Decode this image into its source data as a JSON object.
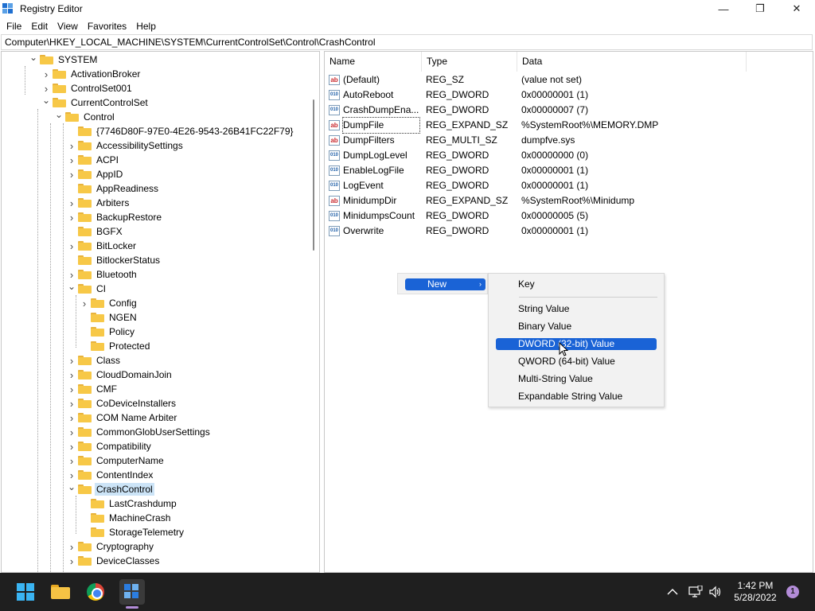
{
  "window": {
    "title": "Registry Editor",
    "minimize_glyph": "—",
    "maximize_glyph": "❐",
    "close_glyph": "✕"
  },
  "menu": [
    "File",
    "Edit",
    "View",
    "Favorites",
    "Help"
  ],
  "address": "Computer\\HKEY_LOCAL_MACHINE\\SYSTEM\\CurrentControlSet\\Control\\CrashControl",
  "tree": [
    {
      "label": "SYSTEM",
      "chevron": "down"
    },
    {
      "label": "ActivationBroker",
      "chevron": "right"
    },
    {
      "label": "ControlSet001",
      "chevron": "right"
    },
    {
      "label": "CurrentControlSet",
      "chevron": "down"
    },
    {
      "label": "Control",
      "chevron": "down"
    },
    {
      "label": "{7746D80F-97E0-4E26-9543-26B41FC22F79}",
      "chevron": "none"
    },
    {
      "label": "AccessibilitySettings",
      "chevron": "right"
    },
    {
      "label": "ACPI",
      "chevron": "right"
    },
    {
      "label": "AppID",
      "chevron": "right"
    },
    {
      "label": "AppReadiness",
      "chevron": "none"
    },
    {
      "label": "Arbiters",
      "chevron": "right"
    },
    {
      "label": "BackupRestore",
      "chevron": "right"
    },
    {
      "label": "BGFX",
      "chevron": "none"
    },
    {
      "label": "BitLocker",
      "chevron": "right"
    },
    {
      "label": "BitlockerStatus",
      "chevron": "none"
    },
    {
      "label": "Bluetooth",
      "chevron": "right"
    },
    {
      "label": "CI",
      "chevron": "down"
    },
    {
      "label": "Config",
      "chevron": "right"
    },
    {
      "label": "NGEN",
      "chevron": "none"
    },
    {
      "label": "Policy",
      "chevron": "none"
    },
    {
      "label": "Protected",
      "chevron": "none"
    },
    {
      "label": "Class",
      "chevron": "right"
    },
    {
      "label": "CloudDomainJoin",
      "chevron": "right"
    },
    {
      "label": "CMF",
      "chevron": "right"
    },
    {
      "label": "CoDeviceInstallers",
      "chevron": "right"
    },
    {
      "label": "COM Name Arbiter",
      "chevron": "right"
    },
    {
      "label": "CommonGlobUserSettings",
      "chevron": "right"
    },
    {
      "label": "Compatibility",
      "chevron": "right"
    },
    {
      "label": "ComputerName",
      "chevron": "right"
    },
    {
      "label": "ContentIndex",
      "chevron": "right"
    },
    {
      "label": "CrashControl",
      "chevron": "down",
      "selected": true
    },
    {
      "label": "LastCrashdump",
      "chevron": "none"
    },
    {
      "label": "MachineCrash",
      "chevron": "none"
    },
    {
      "label": "StorageTelemetry",
      "chevron": "none"
    },
    {
      "label": "Cryptography",
      "chevron": "right"
    },
    {
      "label": "DeviceClasses",
      "chevron": "right"
    }
  ],
  "list": {
    "headers": [
      "Name",
      "Type",
      "Data"
    ],
    "rows": [
      {
        "name": "(Default)",
        "type": "REG_SZ",
        "data": "(value not set)",
        "icon": "ab"
      },
      {
        "name": "AutoReboot",
        "type": "REG_DWORD",
        "data": "0x00000001 (1)",
        "icon": "010"
      },
      {
        "name": "CrashDumpEna...",
        "type": "REG_DWORD",
        "data": "0x00000007 (7)",
        "icon": "010"
      },
      {
        "name": "DumpFile",
        "type": "REG_EXPAND_SZ",
        "data": "%SystemRoot%\\MEMORY.DMP",
        "icon": "ab"
      },
      {
        "name": "DumpFilters",
        "type": "REG_MULTI_SZ",
        "data": "dumpfve.sys",
        "icon": "ab"
      },
      {
        "name": "DumpLogLevel",
        "type": "REG_DWORD",
        "data": "0x00000000 (0)",
        "icon": "010"
      },
      {
        "name": "EnableLogFile",
        "type": "REG_DWORD",
        "data": "0x00000001 (1)",
        "icon": "010"
      },
      {
        "name": "LogEvent",
        "type": "REG_DWORD",
        "data": "0x00000001 (1)",
        "icon": "010"
      },
      {
        "name": "MinidumpDir",
        "type": "REG_EXPAND_SZ",
        "data": "%SystemRoot%\\Minidump",
        "icon": "ab"
      },
      {
        "name": "MinidumpsCount",
        "type": "REG_DWORD",
        "data": "0x00000005 (5)",
        "icon": "010"
      },
      {
        "name": "Overwrite",
        "type": "REG_DWORD",
        "data": "0x00000001 (1)",
        "icon": "010"
      }
    ]
  },
  "context_menu": {
    "new_label": "New",
    "submenu": [
      "Key",
      "String Value",
      "Binary Value",
      "DWORD (32-bit) Value",
      "QWORD (64-bit) Value",
      "Multi-String Value",
      "Expandable String Value"
    ],
    "highlighted": "DWORD (32-bit) Value"
  },
  "taskbar": {
    "time": "1:42 PM",
    "date": "5/28/2022",
    "notification_count": "1",
    "icons": [
      "start-icon",
      "file-explorer-icon",
      "chrome-icon",
      "registry-editor-icon"
    ]
  },
  "colors": {
    "accent": "#1a63d6",
    "selection": "#cce4f7",
    "taskbar": "#1f1f1f",
    "folder": "#f7c847"
  }
}
